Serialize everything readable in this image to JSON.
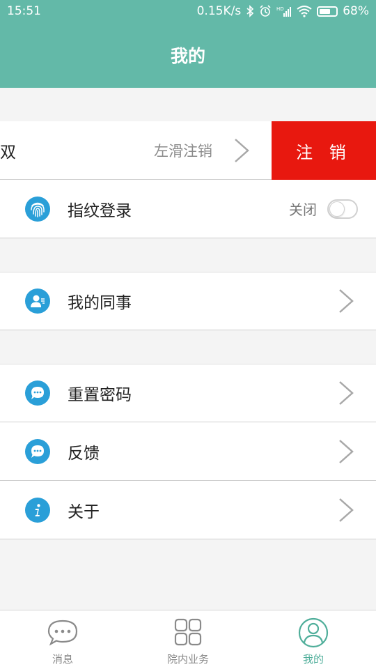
{
  "status_bar": {
    "time": "15:51",
    "net_speed": "0.15K/s",
    "battery": "68%",
    "battery_level": 0.68,
    "icons": [
      "bluetooth-icon",
      "alarm-icon",
      "hd-signal-icon",
      "wifi-icon",
      "battery-icon"
    ]
  },
  "header": {
    "title": "我的"
  },
  "account": {
    "name": "双",
    "swipe_hint": "左滑注销",
    "logout_label": "注 销",
    "logout_color": "#e8180f"
  },
  "fingerprint": {
    "label": "指纹登录",
    "toggle_state": "关闭",
    "enabled": false,
    "icon": "fingerprint-icon"
  },
  "menu": {
    "colleagues": {
      "label": "我的同事",
      "icon": "contact-icon"
    },
    "reset_password": {
      "label": "重置密码",
      "icon": "chat-bubble-icon"
    },
    "feedback": {
      "label": "反馈",
      "icon": "chat-bubble-icon"
    },
    "about": {
      "label": "关于",
      "icon": "info-icon"
    }
  },
  "bottom_nav": {
    "items": [
      {
        "label": "消息",
        "icon": "message-icon",
        "active": false
      },
      {
        "label": "院内业务",
        "icon": "grid-icon",
        "active": false
      },
      {
        "label": "我的",
        "icon": "person-icon",
        "active": true
      }
    ]
  },
  "colors": {
    "header_bg": "#63b9a8",
    "active_tab": "#4fae9a",
    "icon_blue": "#2a9fd8"
  }
}
